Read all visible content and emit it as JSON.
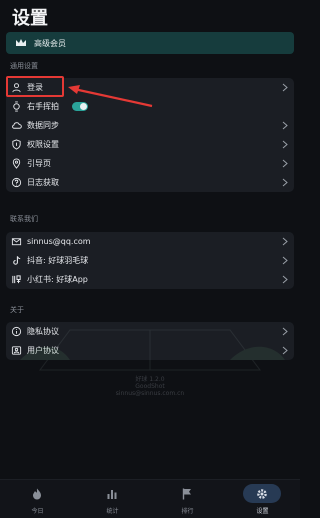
{
  "page": {
    "title": "设置"
  },
  "premium": {
    "label": "高级会员",
    "icon": "crown-icon"
  },
  "general": {
    "section_label": "通用设置",
    "items": [
      {
        "label": "登录",
        "icon": "user-icon",
        "chevron": true
      },
      {
        "label": "右手挥拍",
        "icon": "watch-icon",
        "toggle_on": true
      },
      {
        "label": "数据同步",
        "icon": "cloud-icon",
        "chevron": true
      },
      {
        "label": "权限设置",
        "icon": "shield-icon",
        "chevron": true
      },
      {
        "label": "引导页",
        "icon": "location-pin-icon",
        "chevron": true
      },
      {
        "label": "日志获取",
        "icon": "help-circle-icon",
        "chevron": true
      }
    ]
  },
  "contact": {
    "section_label": "联系我们",
    "items": [
      {
        "label": "sinnus@qq.com",
        "icon": "mail-icon",
        "chevron": true
      },
      {
        "label": "抖音: 好球羽毛球",
        "icon": "tiktok-icon",
        "chevron": true
      },
      {
        "label": "小红书: 好球App",
        "icon": "xiaohongshu-icon",
        "chevron": true
      }
    ]
  },
  "about": {
    "section_label": "关于",
    "items": [
      {
        "label": "隐私协议",
        "icon": "info-icon",
        "chevron": true
      },
      {
        "label": "用户协议",
        "icon": "id-card-icon",
        "chevron": true
      }
    ]
  },
  "version": {
    "line1": "好球 1.2.0",
    "line2": "GoodShot",
    "line3": "sinnus@sinnus.com.cn"
  },
  "tabbar": {
    "items": [
      {
        "label": "今日",
        "icon": "flame-icon"
      },
      {
        "label": "统计",
        "icon": "bar-chart-icon"
      },
      {
        "label": "排行",
        "icon": "flag-icon"
      },
      {
        "label": "设置",
        "icon": "gear-icon",
        "active": true
      }
    ]
  },
  "colors": {
    "background": "#0e1014",
    "card": "#1b1e24",
    "premium_bg": "#163c3d",
    "accent": "#2aa39a",
    "annotation_red": "#e53935",
    "active_tab": "#273a54"
  }
}
